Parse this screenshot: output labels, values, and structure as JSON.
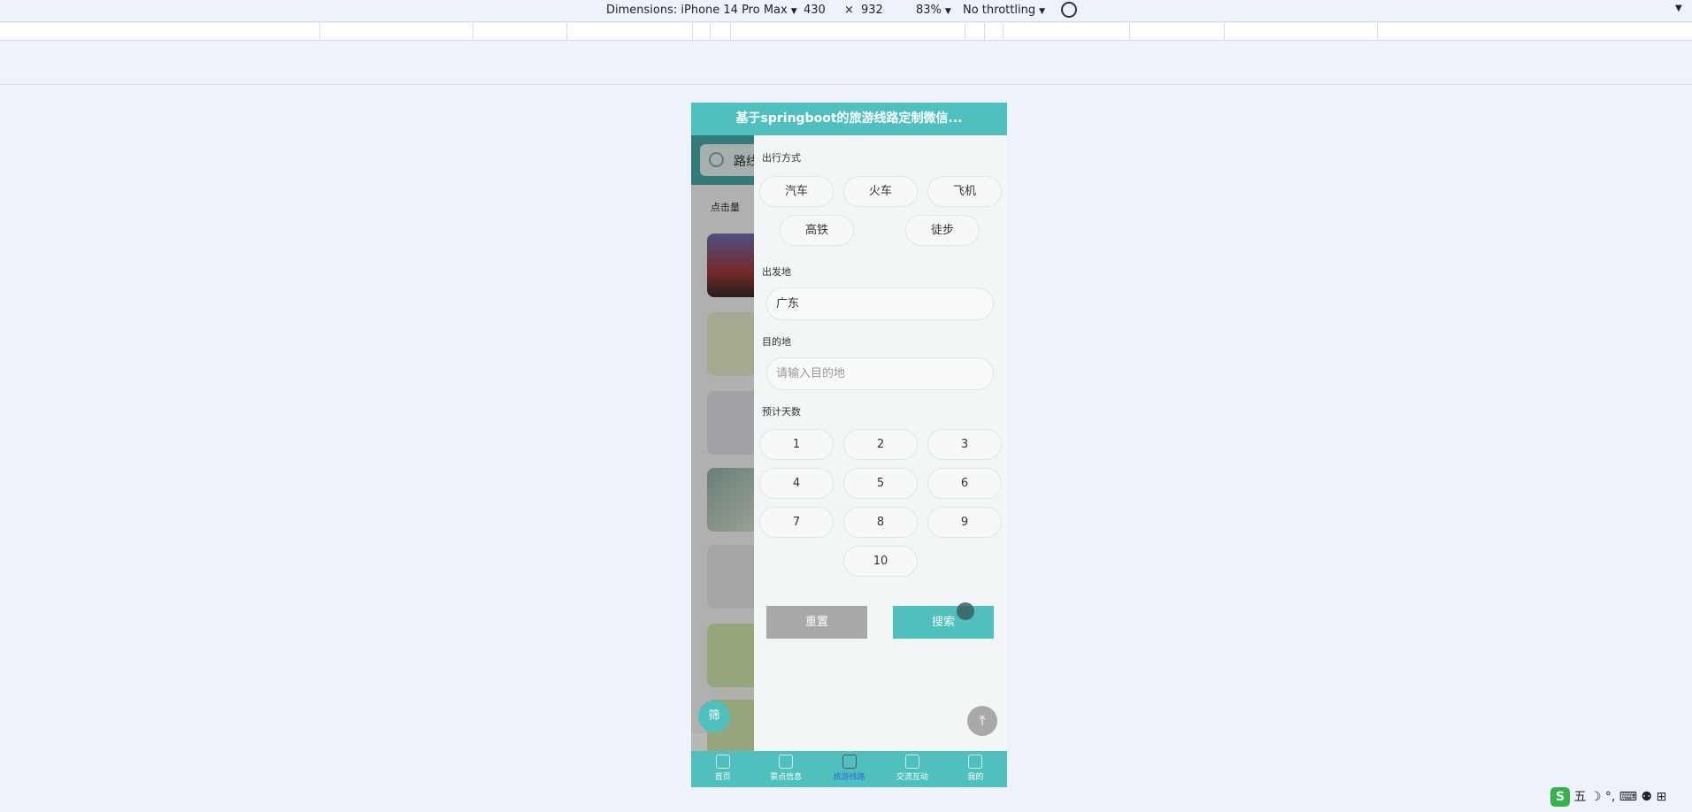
{
  "devtools": {
    "dimensions_label": "Dimensions: iPhone 14 Pro Max",
    "width": "430",
    "times": "×",
    "height": "932",
    "zoom": "83%",
    "throttling": "No throttling",
    "rotate_icon": "rotate-icon",
    "caret": "▼"
  },
  "app": {
    "title": "基于springboot的旅游线路定制微信...",
    "search_text": "路线",
    "sort_label": "点击量"
  },
  "filter": {
    "travel_mode_title": "出行方式",
    "travel_modes": [
      "汽车",
      "火车",
      "飞机",
      "高铁",
      "徒步"
    ],
    "departure_title": "出发地",
    "departure_value": "广东",
    "destination_title": "目的地",
    "destination_placeholder": "请输入目的地",
    "days_title": "预计天数",
    "days": [
      "1",
      "2",
      "3",
      "4",
      "5",
      "6",
      "7",
      "8",
      "9",
      "10"
    ],
    "reset_label": "重置",
    "search_label": "搜索"
  },
  "fab": {
    "filter_label": "筛",
    "to_top_icon": "arrow-up-icon",
    "to_top_glyph": "⤒"
  },
  "tabbar": {
    "tabs": [
      {
        "label": "首页",
        "icon": "home-icon"
      },
      {
        "label": "景点信息",
        "icon": "grid-icon"
      },
      {
        "label": "旅游线路",
        "icon": "route-icon"
      },
      {
        "label": "交流互动",
        "icon": "chat-icon"
      },
      {
        "label": "我的",
        "icon": "user-icon"
      }
    ],
    "active_index": 2
  },
  "ime": {
    "logo": "S",
    "mode": "五",
    "extras": "☽ °, ⌨ ⚉ ⊞"
  },
  "colors": {
    "accent": "#4fc0bd",
    "reset": "#a8a8a8"
  }
}
